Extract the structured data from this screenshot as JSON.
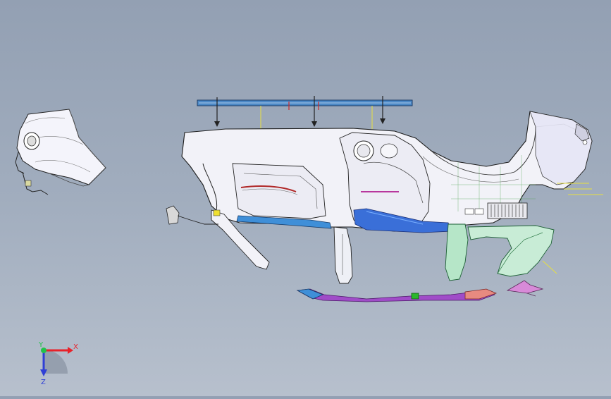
{
  "viewport": {
    "background_top": "#93a0b3",
    "background_bottom": "#b7c0cd"
  },
  "triad": {
    "x_label": "X",
    "y_label": "Y",
    "z_label": "Z",
    "x_color": "#e8222a",
    "y_color": "#22c24a",
    "z_color": "#2f3fd6"
  },
  "parts": [
    {
      "name": "left-rear-quarter-panel"
    },
    {
      "name": "upper-cross-rail"
    },
    {
      "name": "rear-body-assembly"
    },
    {
      "name": "lower-trim-strip"
    },
    {
      "name": "right-corner-bracket"
    }
  ]
}
